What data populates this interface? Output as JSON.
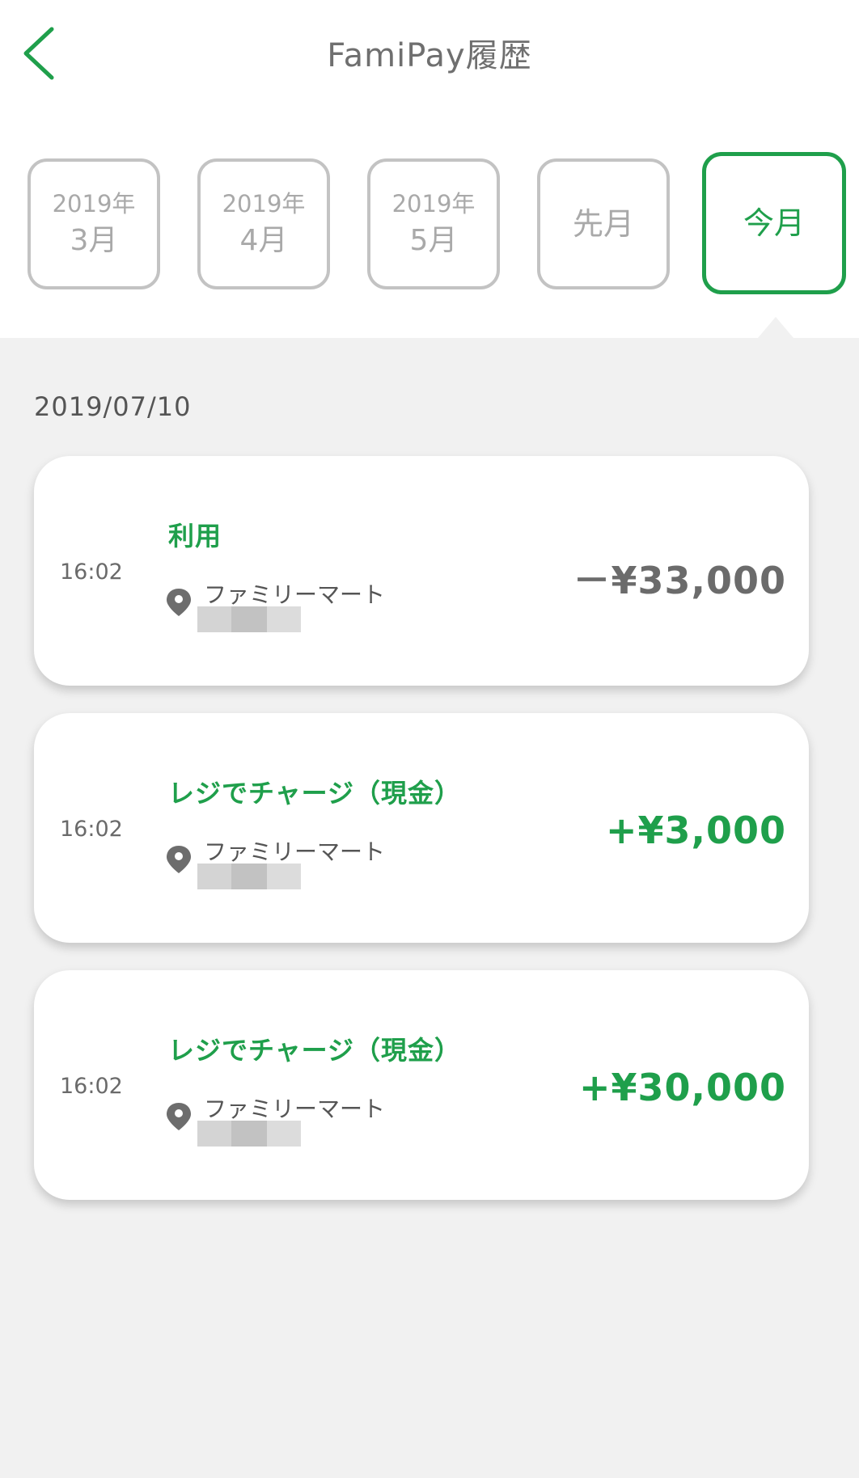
{
  "header": {
    "title": "FamiPay履歴"
  },
  "months": [
    {
      "year": "2019年",
      "month": "3月"
    },
    {
      "year": "2019年",
      "month": "4月"
    },
    {
      "year": "2019年",
      "month": "5月"
    },
    {
      "year": "",
      "month": "先月"
    },
    {
      "year": "",
      "month": "今月"
    }
  ],
  "selected_month_index": 4,
  "date": "2019/07/10",
  "transactions": [
    {
      "time": "16:02",
      "kind": "利用",
      "store": "ファミリーマート",
      "amount": "－¥33,000",
      "amount_color": "#6b6b6b"
    },
    {
      "time": "16:02",
      "kind": "レジでチャージ（現金）",
      "store": "ファミリーマート",
      "amount": "+¥3,000",
      "amount_color": "#1f9f4b"
    },
    {
      "time": "16:02",
      "kind": "レジでチャージ（現金）",
      "store": "ファミリーマート",
      "amount": "+¥30,000",
      "amount_color": "#1f9f4b"
    }
  ],
  "colors": {
    "accent": "#1f9f4b",
    "inactive_border": "#c3c3c3",
    "background": "#f1f1f1"
  },
  "icons": {
    "back": "chevron-left-icon",
    "location": "map-pin-icon"
  }
}
